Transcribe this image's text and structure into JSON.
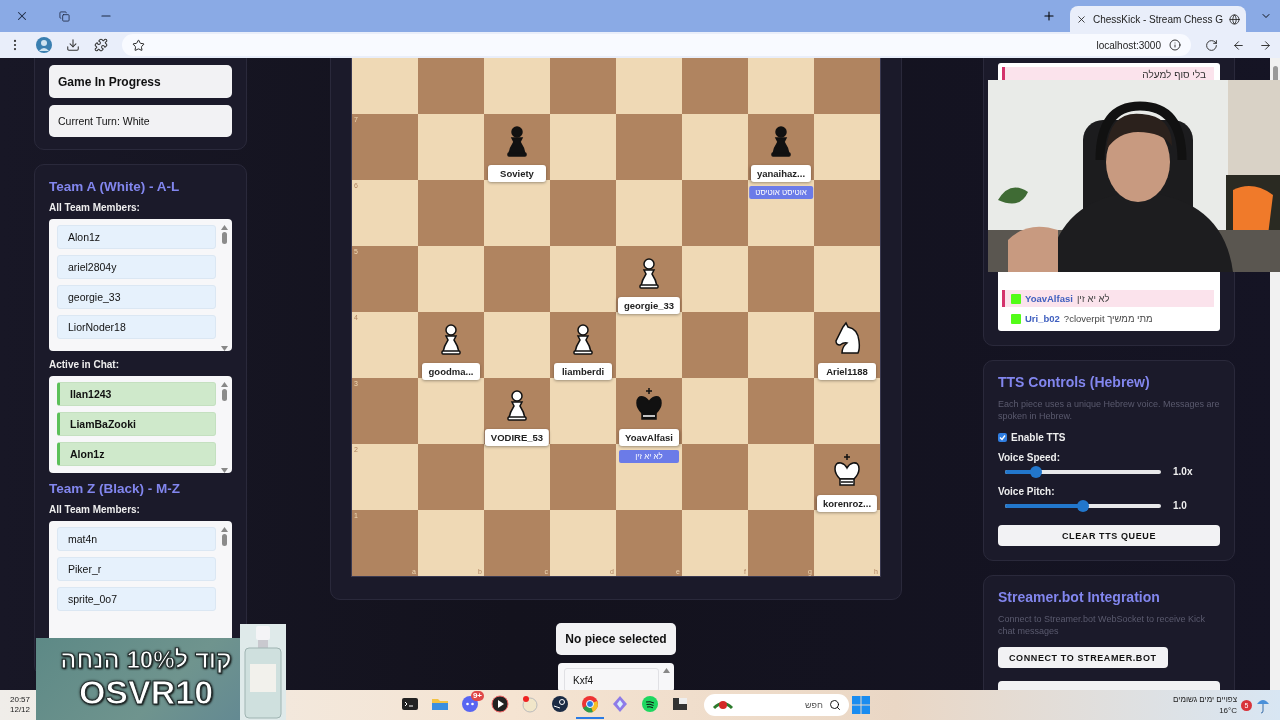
{
  "browser": {
    "tab_title": "ChessKick - Stream Chess G",
    "address": "localhost:3000"
  },
  "game_status": {
    "state": "Game In Progress",
    "turn": "Current Turn: White"
  },
  "teams": [
    {
      "title": "Team A (White) - A-L",
      "members_label": "All Team Members:",
      "members": [
        "Alon1z",
        "ariel2804y",
        "georgie_33",
        "LiorNoder18"
      ],
      "active_label": "Active in Chat:",
      "active": [
        "Ilan1243",
        "LiamBaZooki",
        "Alon1z"
      ]
    },
    {
      "title": "Team Z (Black) - M-Z",
      "members_label": "All Team Members:",
      "members": [
        "mat4n",
        "Piker_r",
        "sprite_0o7"
      ]
    }
  ],
  "board": {
    "file_labels": [
      "a",
      "b",
      "c",
      "d",
      "e",
      "f",
      "g",
      "h"
    ],
    "ranks": [
      {
        "squares": [
          {
            "dark": false
          },
          {
            "dark": true
          },
          {
            "dark": false
          },
          {
            "dark": true
          },
          {
            "dark": false
          },
          {
            "dark": true
          },
          {
            "dark": false
          },
          {
            "dark": true
          }
        ]
      },
      {
        "label": "7",
        "squares": [
          {
            "dark": true
          },
          {
            "dark": false
          },
          {
            "dark": true,
            "kind": "pawn",
            "black": true,
            "player": "Soviety"
          },
          {
            "dark": false
          },
          {
            "dark": true
          },
          {
            "dark": false
          },
          {
            "dark": true,
            "kind": "pawn",
            "black": true,
            "player": "yanaihaz...",
            "badge": "אוטיסט אוטיסט"
          },
          {
            "dark": false
          }
        ]
      },
      {
        "label": "6",
        "squares": [
          {
            "dark": false
          },
          {
            "dark": true
          },
          {
            "dark": false
          },
          {
            "dark": true
          },
          {
            "dark": false
          },
          {
            "dark": true
          },
          {
            "dark": false
          },
          {
            "dark": true
          }
        ]
      },
      {
        "label": "5",
        "squares": [
          {
            "dark": true
          },
          {
            "dark": false
          },
          {
            "dark": true
          },
          {
            "dark": false
          },
          {
            "dark": true,
            "kind": "pawn",
            "black": false,
            "player": "georgie_33"
          },
          {
            "dark": false
          },
          {
            "dark": true
          },
          {
            "dark": false
          }
        ]
      },
      {
        "label": "4",
        "squares": [
          {
            "dark": false
          },
          {
            "dark": true,
            "kind": "pawn",
            "black": false,
            "player": "goodma..."
          },
          {
            "dark": false
          },
          {
            "dark": true,
            "kind": "pawn",
            "black": false,
            "player": "liamberdi"
          },
          {
            "dark": false
          },
          {
            "dark": true
          },
          {
            "dark": false
          },
          {
            "dark": true,
            "kind": "knight",
            "black": false,
            "player": "Ariel1188"
          }
        ]
      },
      {
        "label": "3",
        "squares": [
          {
            "dark": true
          },
          {
            "dark": false
          },
          {
            "dark": true,
            "kind": "pawn",
            "black": false,
            "player": "VODIRE_53"
          },
          {
            "dark": false
          },
          {
            "dark": true,
            "kind": "king",
            "black": true,
            "player": "YoavAlfasi",
            "badge": "לא יא זין"
          },
          {
            "dark": false
          },
          {
            "dark": true
          },
          {
            "dark": false
          }
        ]
      },
      {
        "label": "2",
        "squares": [
          {
            "dark": false
          },
          {
            "dark": true
          },
          {
            "dark": false
          },
          {
            "dark": true
          },
          {
            "dark": false
          },
          {
            "dark": true
          },
          {
            "dark": false
          },
          {
            "dark": true,
            "kind": "king",
            "black": false,
            "player": "korenroz..."
          }
        ]
      },
      {
        "label": "1",
        "squares": [
          {
            "dark": true
          },
          {
            "dark": false
          },
          {
            "dark": true
          },
          {
            "dark": false
          },
          {
            "dark": true
          },
          {
            "dark": false
          },
          {
            "dark": true
          },
          {
            "dark": false
          }
        ]
      }
    ]
  },
  "selection": {
    "status": "No piece selected",
    "moves": [
      "Kxf4"
    ]
  },
  "chat": {
    "pinned": "בלי סוף למעלה",
    "messages": [
      {
        "user": "YoavAlfasi",
        "text": "לא יא זין",
        "highlighted": true
      },
      {
        "user": "Uri_b02",
        "text": "מתי ממשיך cloverpit?",
        "highlighted": false
      }
    ]
  },
  "tts": {
    "title": "TTS Controls (Hebrew)",
    "description": "Each piece uses a unique Hebrew voice. Messages are spoken in Hebrew.",
    "enable": {
      "label": "Enable TTS",
      "checked": true
    },
    "sliders": [
      {
        "label": "Voice Speed:",
        "level": 0.2,
        "reading": "1.0x"
      },
      {
        "label": "Voice Pitch:",
        "level": 0.5,
        "reading": "1.0"
      }
    ],
    "button": "CLEAR TTS QUEUE"
  },
  "streamer": {
    "title": "Streamer.bot Integration",
    "description": "Connect to Streamer.bot WebSocket to receive Kick chat messages",
    "button": "CONNECT TO STREAMER.BOT"
  },
  "promo": {
    "line1": "קוד ל10% הנחה",
    "line2": "OSVR10"
  },
  "taskbar": {
    "clock_time": "20:57",
    "clock_date": "12/12",
    "search_placeholder": "חפש",
    "weather_text": "צפויים ימים גשומים",
    "temperature": "16°C",
    "weather_badge": "5",
    "apps": [
      {
        "kind": "terminal"
      },
      {
        "kind": "folder"
      },
      {
        "kind": "chat",
        "badge": "9+"
      },
      {
        "kind": "player"
      },
      {
        "kind": "app"
      },
      {
        "kind": "steam"
      },
      {
        "kind": "browser",
        "active": true
      },
      {
        "kind": "gem"
      },
      {
        "kind": "music"
      },
      {
        "kind": "window"
      }
    ]
  }
}
